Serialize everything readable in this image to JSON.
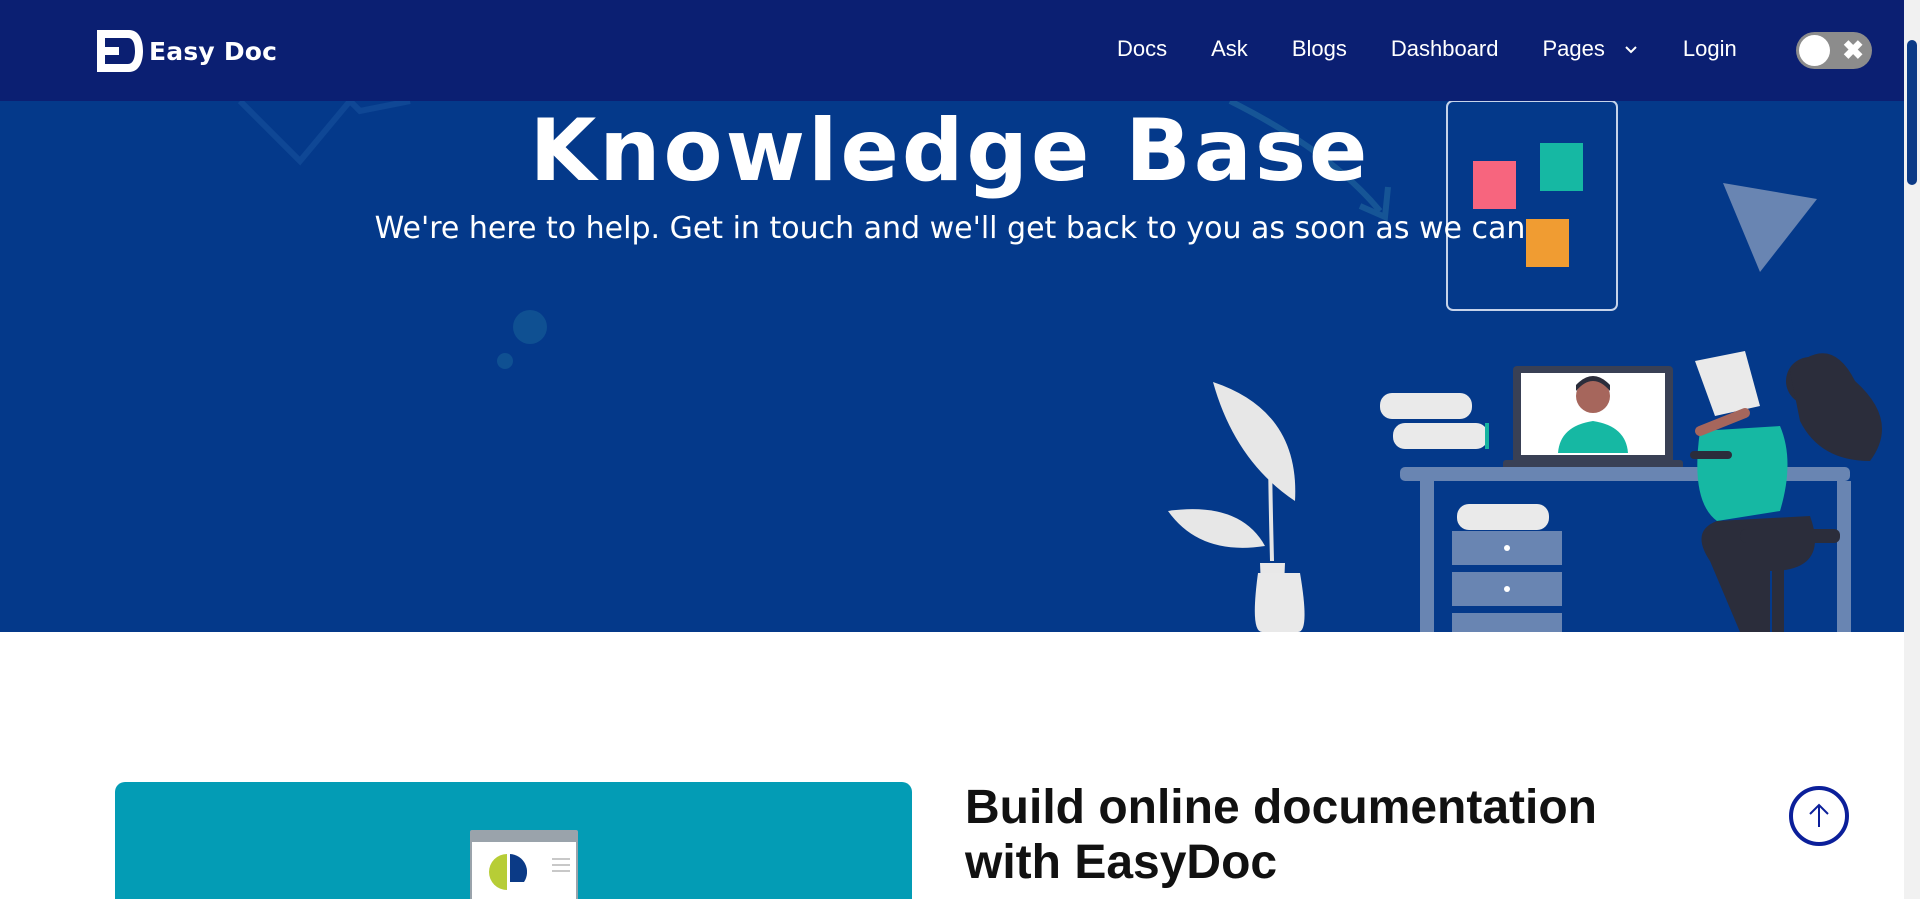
{
  "brand": {
    "name": "Easy Doc"
  },
  "nav": {
    "items": [
      "Docs",
      "Ask",
      "Blogs",
      "Dashboard",
      "Pages",
      "Login"
    ],
    "pages_dropdown_icon": "chevron-down-icon",
    "theme_toggle_icon": "close-icon"
  },
  "hero": {
    "title": "Knowledge Base",
    "subtitle": "We're here to help. Get in touch and we'll get back to you as soon as we can"
  },
  "feature": {
    "title": "Build online documentation with EasyDoc"
  },
  "back_to_top_icon": "arrow-up-icon",
  "colors": {
    "navbar": "#0b1f72",
    "hero": "#04398a",
    "card": "#039cb5",
    "accent": "#0b1f9a"
  }
}
